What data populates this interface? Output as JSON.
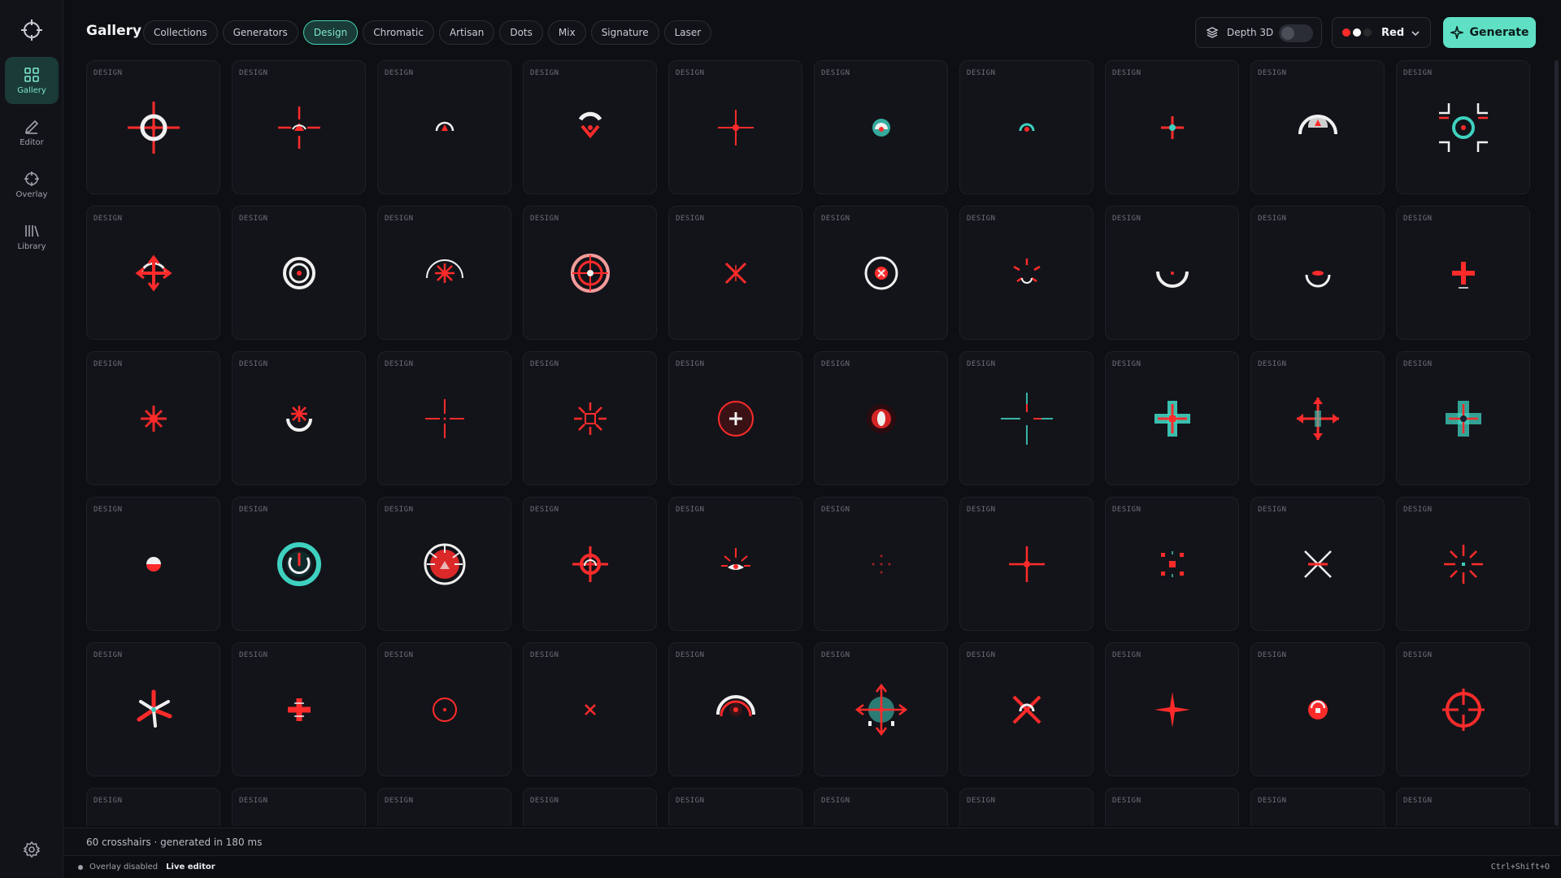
{
  "sidebar": {
    "items": [
      {
        "label": "Gallery",
        "icon": "grid-icon",
        "active": true
      },
      {
        "label": "Editor",
        "icon": "pencil-icon",
        "active": false
      },
      {
        "label": "Overlay",
        "icon": "crosshair-icon",
        "active": false
      },
      {
        "label": "Library",
        "icon": "library-icon",
        "active": false
      }
    ]
  },
  "header": {
    "title": "Gallery",
    "tabs": [
      {
        "label": "Collections",
        "active": false
      },
      {
        "label": "Generators",
        "active": false
      },
      {
        "label": "Design",
        "active": true
      },
      {
        "label": "Chromatic",
        "active": false
      },
      {
        "label": "Artisan",
        "active": false
      },
      {
        "label": "Dots",
        "active": false
      },
      {
        "label": "Mix",
        "active": false
      },
      {
        "label": "Signature",
        "active": false
      },
      {
        "label": "Laser",
        "active": false
      }
    ],
    "depth_label": "Depth 3D",
    "depth_enabled": false,
    "color_label": "Red",
    "color_dots": [
      "#ff2a2a",
      "#ffffff",
      "#222222"
    ],
    "generate_label": "Generate"
  },
  "colors": {
    "accent": "#5fe0c5",
    "red": "#ff2b2b",
    "teal": "#3fd1c0",
    "white": "#f0f0f0"
  },
  "gallery": {
    "card_tag": "DESIGN",
    "cards": [
      {
        "style": "ring-cross-white"
      },
      {
        "style": "arrows-4"
      },
      {
        "style": "arc-small"
      },
      {
        "style": "chevron-arc"
      },
      {
        "style": "cross-thin"
      },
      {
        "style": "dot-teal"
      },
      {
        "style": "ring-teal-small"
      },
      {
        "style": "cross-teal-center"
      },
      {
        "style": "dome-white"
      },
      {
        "style": "brackets-teal"
      },
      {
        "style": "arrows-4-round"
      },
      {
        "style": "ring-double-white"
      },
      {
        "style": "asterisk-ring"
      },
      {
        "style": "target-glow"
      },
      {
        "style": "x-mark"
      },
      {
        "style": "ring-x-white"
      },
      {
        "style": "starburst"
      },
      {
        "style": "cup-white"
      },
      {
        "style": "cup-small"
      },
      {
        "style": "plus-bold"
      },
      {
        "style": "star-glow"
      },
      {
        "style": "asterisk-cup"
      },
      {
        "style": "cross-gap"
      },
      {
        "style": "sunburst"
      },
      {
        "style": "ring-plus"
      },
      {
        "style": "pill-glow"
      },
      {
        "style": "cross-long-teal"
      },
      {
        "style": "plus-teal-arrows"
      },
      {
        "style": "arrows-teal-plus"
      },
      {
        "style": "plus-teal-dark"
      },
      {
        "style": "dot-half"
      },
      {
        "style": "power-teal"
      },
      {
        "style": "sun-disc"
      },
      {
        "style": "ring-cross-red"
      },
      {
        "style": "eye-rays"
      },
      {
        "style": "dots-faint"
      },
      {
        "style": "cross-dot"
      },
      {
        "style": "square-dots"
      },
      {
        "style": "x-white"
      },
      {
        "style": "rays-8"
      },
      {
        "style": "propeller"
      },
      {
        "style": "cross-stubby"
      },
      {
        "style": "ring-dot"
      },
      {
        "style": "x-small"
      },
      {
        "style": "arc-target"
      },
      {
        "style": "teal-compass"
      },
      {
        "style": "x-arc"
      },
      {
        "style": "plus-thin"
      },
      {
        "style": "ring-square"
      },
      {
        "style": "circle-cross"
      },
      {
        "style": "empty"
      },
      {
        "style": "empty"
      },
      {
        "style": "empty"
      },
      {
        "style": "empty"
      },
      {
        "style": "empty"
      },
      {
        "style": "empty"
      },
      {
        "style": "empty"
      },
      {
        "style": "empty"
      },
      {
        "style": "empty"
      },
      {
        "style": "empty"
      }
    ]
  },
  "status": {
    "summary": "60 crosshairs · generated in 180 ms"
  },
  "footer": {
    "overlay": "Overlay disabled",
    "live": "Live editor",
    "shortcut": "Ctrl+Shift+O"
  }
}
